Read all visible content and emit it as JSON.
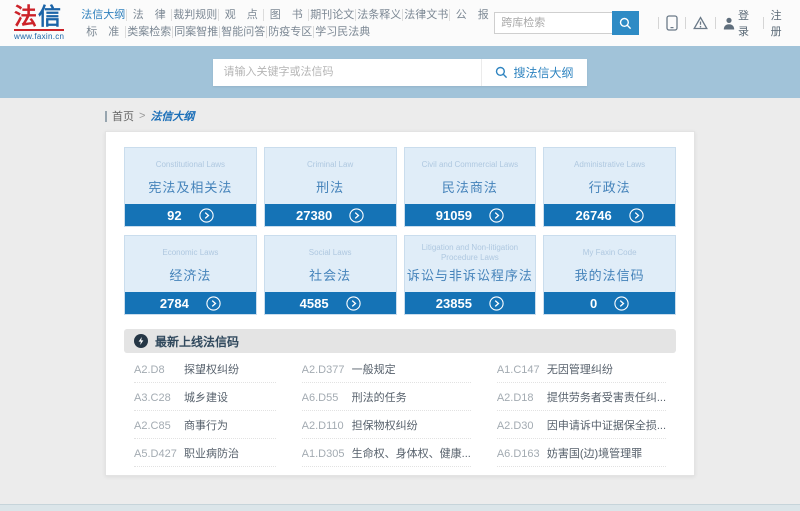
{
  "brand": {
    "logo_fa": "法",
    "logo_xin": "信",
    "site_url": "www.faxin.cn"
  },
  "topnav": {
    "row1": [
      {
        "label": "法信大纲"
      },
      {
        "label": "法　律"
      },
      {
        "label": "裁判规则"
      },
      {
        "label": "观　点"
      },
      {
        "label": "图　书"
      },
      {
        "label": "期刊论文"
      },
      {
        "label": "法条释义"
      },
      {
        "label": "法律文书"
      },
      {
        "label": "公　报"
      }
    ],
    "row2": [
      {
        "label": "标　准"
      },
      {
        "label": "类案检索"
      },
      {
        "label": "同案智推"
      },
      {
        "label": "智能问答"
      },
      {
        "label": "防疫专区"
      },
      {
        "label": "学习民法典"
      }
    ]
  },
  "header_search": {
    "placeholder": "跨库检索"
  },
  "user_actions": {
    "login": "登录",
    "register": "注册"
  },
  "main_search": {
    "placeholder": "请输入关键字或法信码",
    "button_label": "搜法信大纲"
  },
  "breadcrumb": {
    "home": "首页",
    "separator": ">",
    "current": "法信大纲"
  },
  "cards": [
    {
      "en": "Constitutional Laws",
      "zh": "宪法及相关法",
      "count": "92"
    },
    {
      "en": "Criminal Law",
      "zh": "刑法",
      "count": "27380"
    },
    {
      "en": "Civil and Commercial Laws",
      "zh": "民法商法",
      "count": "91059"
    },
    {
      "en": "Administrative Laws",
      "zh": "行政法",
      "count": "26746"
    },
    {
      "en": "Economic Laws",
      "zh": "经济法",
      "count": "2784"
    },
    {
      "en": "Social Laws",
      "zh": "社会法",
      "count": "4585"
    },
    {
      "en": "Litigation and Non-litigation Procedure Laws",
      "zh": "诉讼与非诉讼程序法",
      "count": "23855"
    },
    {
      "en": "My Faxin Code",
      "zh": "我的法信码",
      "count": "0"
    }
  ],
  "latest_section": {
    "title": "最新上线法信码"
  },
  "latest_columns": [
    [
      {
        "code": "A2.D8",
        "title": "探望权纠纷"
      },
      {
        "code": "A3.C28",
        "title": "城乡建设"
      },
      {
        "code": "A2.C85",
        "title": "商事行为"
      },
      {
        "code": "A5.D427",
        "title": "职业病防治"
      }
    ],
    [
      {
        "code": "A2.D377",
        "title": "一般规定"
      },
      {
        "code": "A6.D55",
        "title": "刑法的任务"
      },
      {
        "code": "A2.D110",
        "title": "担保物权纠纷"
      },
      {
        "code": "A1.D305",
        "title": "生命权、身体权、健康..."
      }
    ],
    [
      {
        "code": "A1.C147",
        "title": "无因管理纠纷"
      },
      {
        "code": "A2.D18",
        "title": "提供劳务者受害责任纠..."
      },
      {
        "code": "A2.D30",
        "title": "因申请诉中证据保全损..."
      },
      {
        "code": "A6.D163",
        "title": "妨害国(边)境管理罪"
      }
    ]
  ],
  "colors": {
    "accent_blue": "#1573b6",
    "band_blue": "#a1c3d9",
    "logo_red": "#cc2229",
    "logo_blue": "#1b64a8"
  },
  "icons": {
    "search": "magnifier",
    "mobile": "phone-outline",
    "warning": "triangle-exclamation",
    "user": "person-silhouette",
    "card_arrow": "chevron-right-in-circle",
    "section_badge": "dark-circle-code-mark"
  }
}
